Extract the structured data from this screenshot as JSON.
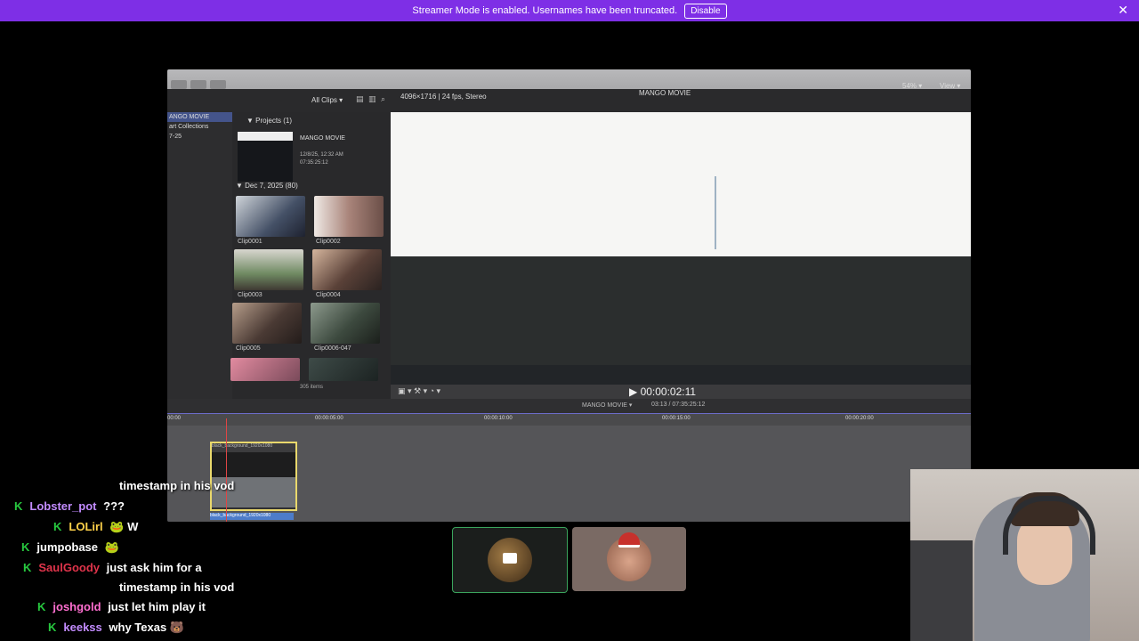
{
  "banner": {
    "message": "Streamer Mode is enabled. Usernames have been truncated.",
    "disable_label": "Disable",
    "close_symbol": "✕",
    "color": "#7e2fe6"
  },
  "editor": {
    "all_clips": "All Clips ▾",
    "format": "4096×1716 | 24 fps, Stereo",
    "project_title": "MANGO MOVIE",
    "zoom": "54% ▾",
    "view": "View ▾",
    "sidebar": [
      "ANGO MOVIE",
      "art Collections",
      "7-25"
    ],
    "projects_header": "▼ Projects  (1)",
    "project_name": "MANGO MOVIE",
    "project_meta": [
      "12/8/25, 12:32 AM",
      "07:35:25:12"
    ],
    "event_header": "▼ Dec 7, 2025  (80)",
    "clips": [
      "Clip0001",
      "Clip0002",
      "Clip0003",
      "Clip0004",
      "Clip0005",
      "Clip0006-047"
    ],
    "items_count": "305 items",
    "timecode": "▶ 00:00:02:11",
    "timeline_name": "MANGO MOVIE ▾",
    "timeline_duration": "03:13 / 07:35:25:12",
    "ruler": [
      "00:00",
      "00:00:05:00",
      "00:00:10:00",
      "00:00:15:00",
      "00:00:20:00"
    ],
    "tl_clip_name": "black_background_1920x1080",
    "tl_clip_label": "black_background_1920x1080"
  },
  "chat": {
    "badge": "K",
    "messages": [
      {
        "user": "",
        "user_color": "#ffffff",
        "text": "timestamp in his vod",
        "emote": ""
      },
      {
        "user": "Lobster_pot",
        "user_color": "#c38cff",
        "text": "???",
        "emote": ""
      },
      {
        "user": "LOLirl",
        "user_color": "#ffd24a",
        "text": "",
        "emote": "🐸 W"
      },
      {
        "user": "jumpobase",
        "user_color": "#ffffff",
        "text": "",
        "emote": "🐸"
      },
      {
        "user": "SaulGoody",
        "user_color": "#e0344b",
        "text": "just ask him for a",
        "emote": ""
      },
      {
        "user": "",
        "user_color": "#ffffff",
        "text": "timestamp in his vod",
        "emote": ""
      },
      {
        "user": "joshgold",
        "user_color": "#ff6fd0",
        "text": "just let him play it",
        "emote": ""
      },
      {
        "user": "keekss",
        "user_color": "#c38cff",
        "text": "why Texas",
        "emote": "🐻"
      }
    ]
  }
}
